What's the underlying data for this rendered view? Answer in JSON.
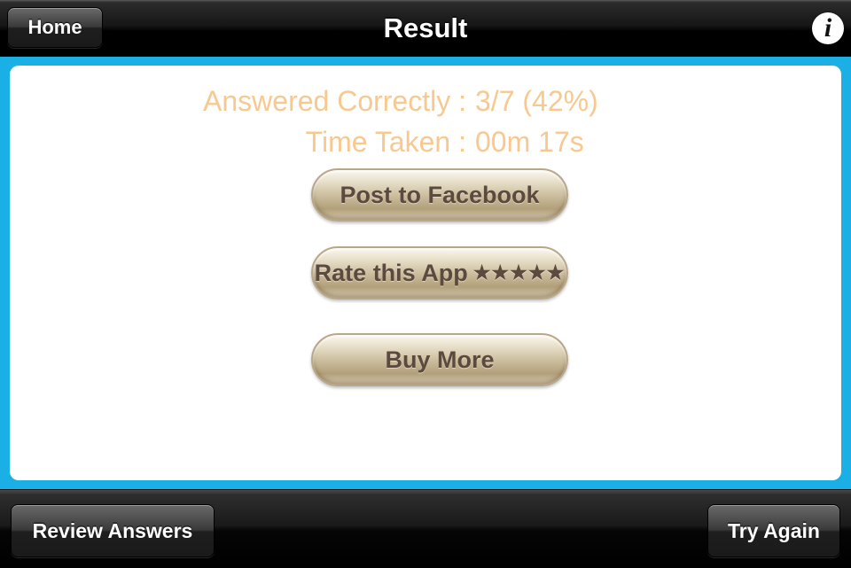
{
  "navbar": {
    "title": "Result",
    "home_label": "Home",
    "info_glyph": "i",
    "info_icon": "info-icon"
  },
  "colors": {
    "frame_blue": "#1ab0e6",
    "stat_text": "#f7c990",
    "button_text": "#5b4a3d"
  },
  "result": {
    "correct_label": "Answered Correctly :",
    "correct_value": "3/7 (42%)",
    "time_label": "Time Taken :",
    "time_value": "00m 17s"
  },
  "actions": {
    "facebook_label": "Post to Facebook",
    "rate_label": "Rate this App",
    "rate_stars": "★★★★★",
    "buy_label": "Buy More"
  },
  "toolbar": {
    "review_label": "Review Answers",
    "try_again_label": "Try Again"
  }
}
